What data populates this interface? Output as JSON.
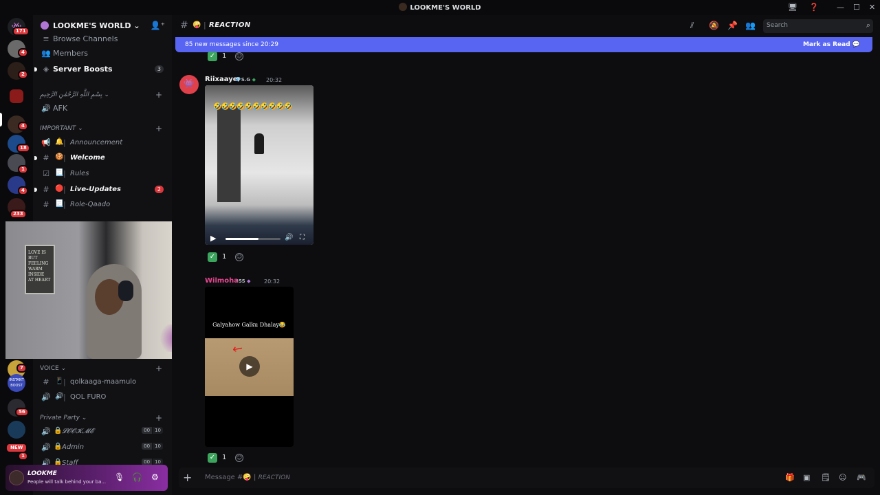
{
  "window": {
    "title": "LOOKME'S WORLD"
  },
  "rail": {
    "home_badge": "171",
    "badges": [
      "4",
      "2",
      "4",
      "18",
      "1",
      "4",
      "233",
      "7",
      "56"
    ],
    "new_label": "NEW",
    "new_count": "1"
  },
  "server": {
    "name": "LOOKME'S WORLD",
    "top_items": [
      {
        "label": "Browse Channels"
      },
      {
        "label": "Members"
      },
      {
        "label": "Server Boosts",
        "count": "3"
      }
    ],
    "categories": {
      "arabic": "بِسْمِ اللَّهِ الرَّحْمَٰنِ الرَّحِيمِ",
      "important": "IMPORTANT",
      "voice": "VOICE",
      "private": "Private Party"
    },
    "afk": "AFK",
    "important_channels": [
      {
        "emoji": "🔔",
        "label": "Announcement",
        "unread": false
      },
      {
        "emoji": "🍪",
        "label": "Welcome",
        "unread": true
      },
      {
        "emoji": "📃",
        "label": "Rules",
        "unread": false
      },
      {
        "emoji": "🔴",
        "label": "Live-Updates",
        "unread": true,
        "count": "2"
      },
      {
        "emoji": "📃",
        "label": "Role-Qaado",
        "unread": false
      }
    ],
    "voice_channels": [
      {
        "emoji": "📱",
        "label": "qolkaaga-maamulo"
      },
      {
        "emoji": "🔊",
        "label": "QOL FURO"
      }
    ],
    "private_channels": [
      {
        "emoji": "🔒",
        "label": "𝓛𝓞𝓞𝓚𝓜𝓔",
        "a": "00",
        "b": "10"
      },
      {
        "emoji": "🔒",
        "label": "Admin",
        "a": "00",
        "b": "10"
      },
      {
        "emoji": "🔒",
        "label": "Staff",
        "a": "00",
        "b": "10"
      }
    ]
  },
  "user": {
    "name": "LOOKME",
    "status": "People will talk behind your ba..."
  },
  "webcam": {
    "poster": "LOVE IS\nBUT FEELING\nWARM INSIDE\nAT HEART"
  },
  "channel": {
    "name": "REACTION",
    "emoji": "🤪",
    "search_placeholder": "Search"
  },
  "new_messages": {
    "text": "85 new messages since 20:29",
    "action": "Mark as Read"
  },
  "messages": [
    {
      "author": "Riixaaye",
      "tag": "S.G",
      "time": "20:32",
      "name_color": "#f2f3f5",
      "video_emojis": "🤣🤣🤣🤣🤣🤣🤣🤣🤣🤣",
      "video_progress": 0.6,
      "reaction_count": "1"
    },
    {
      "author": "Wilmoha",
      "tag": "SS",
      "time": "20:32",
      "name_color": "#e4478f",
      "video_caption": "Galyahow Galku Dhalay😂",
      "reaction_count": "1"
    }
  ],
  "top_reaction_count": "1",
  "composer": {
    "placeholder": "Message #",
    "channel": "REACTION"
  }
}
